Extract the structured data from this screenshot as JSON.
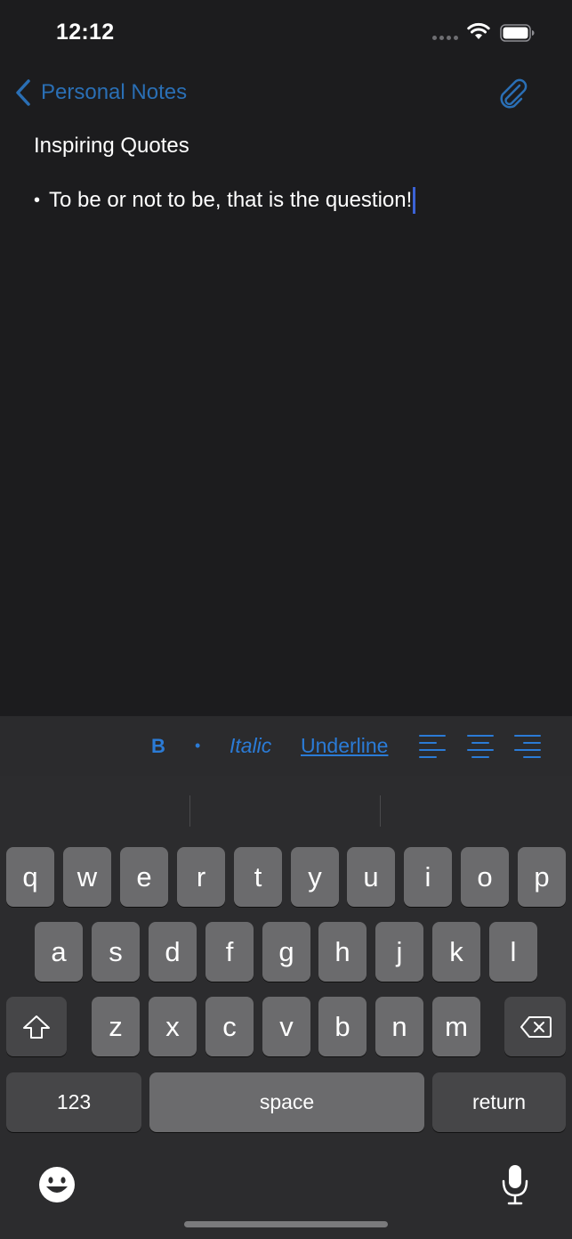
{
  "status_bar": {
    "time": "12:12"
  },
  "nav": {
    "back_label": "Personal Notes"
  },
  "note": {
    "title": "Inspiring Quotes",
    "bullet": "•",
    "line": "To be or not to be, that is the question!"
  },
  "toolbar": {
    "bold": "B",
    "dot": "•",
    "italic": "Italic",
    "underline": "Underline"
  },
  "keyboard": {
    "row1": [
      "q",
      "w",
      "e",
      "r",
      "t",
      "y",
      "u",
      "i",
      "o",
      "p"
    ],
    "row2": [
      "a",
      "s",
      "d",
      "f",
      "g",
      "h",
      "j",
      "k",
      "l"
    ],
    "row3": [
      "z",
      "x",
      "c",
      "v",
      "b",
      "n",
      "m"
    ],
    "numbers": "123",
    "space": "space",
    "return": "return"
  },
  "colors": {
    "accent": "#2b7bd6",
    "background": "#1c1c1e",
    "caret": "#3b62d6"
  }
}
